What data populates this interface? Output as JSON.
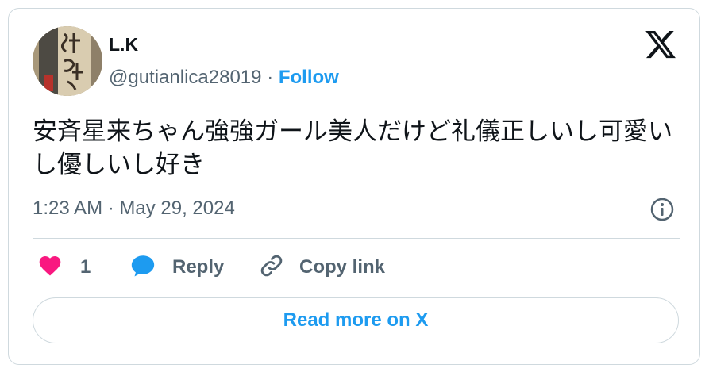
{
  "author": {
    "name": "L.K",
    "handle": "@gutianlica28019",
    "separator": "·",
    "follow_label": "Follow"
  },
  "tweet": {
    "text": "安斉星来ちゃん強強ガール美人だけど礼儀正しいし可愛いし優しいし好き",
    "timestamp": "1:23 AM · May 29, 2024"
  },
  "actions": {
    "like_count": "1",
    "reply_label": "Reply",
    "copy_link_label": "Copy link"
  },
  "read_more_label": "Read more on X",
  "colors": {
    "accent": "#1d9bf0",
    "like": "#f91880",
    "muted": "#536471",
    "border": "#cfd9de"
  },
  "icons": [
    "x-logo-icon",
    "info-icon",
    "heart-icon",
    "reply-icon",
    "link-icon"
  ]
}
